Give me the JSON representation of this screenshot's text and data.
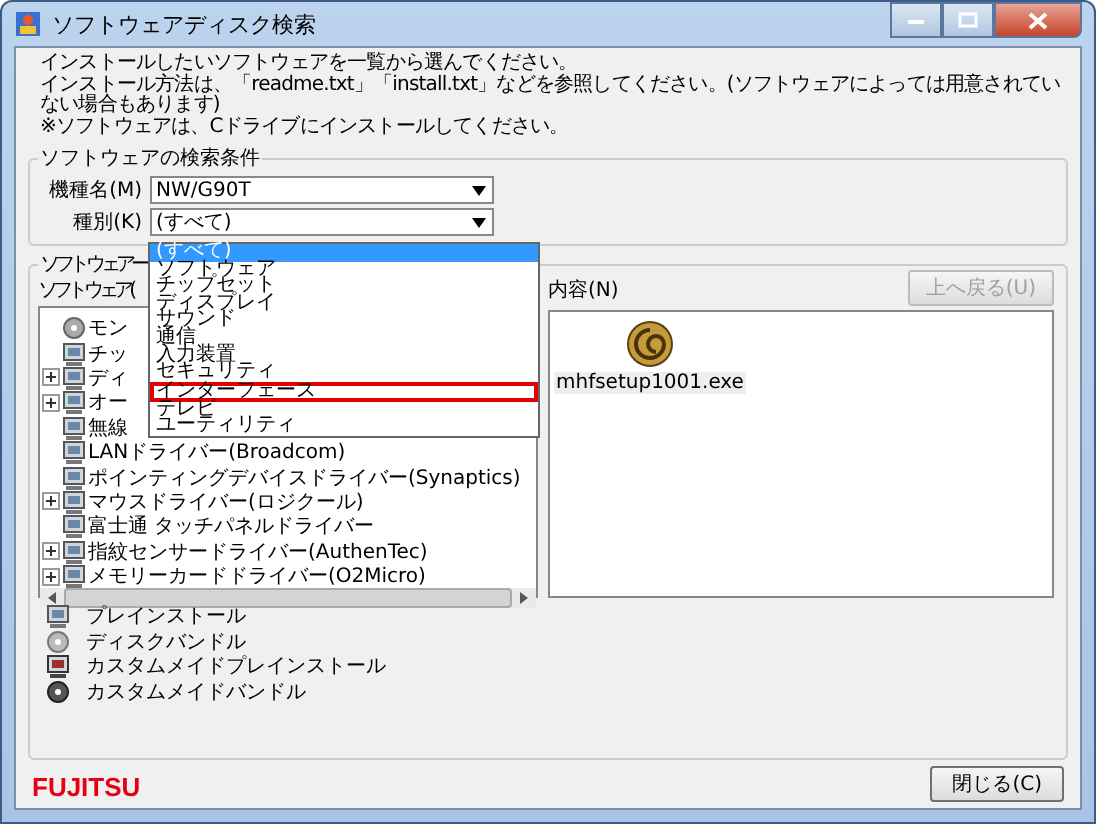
{
  "window": {
    "title": "ソフトウェアディスク検索"
  },
  "intro": [
    "インストールしたいソフトウェアを一覧から選んでください。",
    "インストール方法は、「readme.txt」「install.txt」などを参照してください。(ソフトウェアによっては用意されていない場合もあります)",
    "※ソフトウェアは、Cドライブにインストールしてください。"
  ],
  "search": {
    "legend": "ソフトウェアの検索条件",
    "model_label": "機種名(M)",
    "model_value": "NW/G90T",
    "type_label": "種別(K)",
    "type_value": "(すべて)",
    "type_options": [
      {
        "label": "(すべて)",
        "selected": true,
        "emphasized": false
      },
      {
        "label": "ソフトウェア",
        "selected": false,
        "emphasized": false
      },
      {
        "label": "チップセット",
        "selected": false,
        "emphasized": false
      },
      {
        "label": "ディスプレイ",
        "selected": false,
        "emphasized": false
      },
      {
        "label": "サウンド",
        "selected": false,
        "emphasized": false
      },
      {
        "label": "通信",
        "selected": false,
        "emphasized": false
      },
      {
        "label": "入力装置",
        "selected": false,
        "emphasized": false
      },
      {
        "label": "セキュリティ",
        "selected": false,
        "emphasized": false
      },
      {
        "label": "インターフェース",
        "selected": false,
        "emphasized": true
      },
      {
        "label": "テレビ",
        "selected": false,
        "emphasized": false
      },
      {
        "label": "ユーティリティ",
        "selected": false,
        "emphasized": false
      }
    ]
  },
  "list": {
    "legend": "ソフトウェアー",
    "tree_label": "ソフトウェア(",
    "tree": [
      {
        "label": "モン",
        "kind": "disc",
        "expandable": false
      },
      {
        "label": "チッ",
        "kind": "preinstall",
        "expandable": false
      },
      {
        "label": "ディ",
        "kind": "preinstall",
        "expandable": true
      },
      {
        "label": "オー",
        "kind": "preinstall",
        "expandable": true
      },
      {
        "label": "無線",
        "kind": "preinstall",
        "expandable": false
      },
      {
        "label": "LANドライバー(Broadcom)",
        "kind": "preinstall",
        "expandable": false
      },
      {
        "label": "ポインティングデバイスドライバー(Synaptics)",
        "kind": "preinstall",
        "expandable": false
      },
      {
        "label": "マウスドライバー(ロジクール)",
        "kind": "preinstall",
        "expandable": true
      },
      {
        "label": "富士通 タッチパネルドライバー",
        "kind": "preinstall",
        "expandable": false
      },
      {
        "label": "指紋センサードライバー(AuthenTec)",
        "kind": "preinstall",
        "expandable": true
      },
      {
        "label": "メモリーカードドライバー(O2Micro)",
        "kind": "preinstall",
        "expandable": true
      }
    ],
    "content_label": "内容(N)",
    "up_button": {
      "label": "上へ戻る(U)",
      "disabled": true
    },
    "files": [
      "mhfsetup1001.exe"
    ]
  },
  "legend": [
    {
      "label": "プレインストール",
      "kind": "preinstall"
    },
    {
      "label": "ディスクバンドル",
      "kind": "disc"
    },
    {
      "label": "カスタムメイドプレインストール",
      "kind": "custom-preinstall"
    },
    {
      "label": "カスタムメイドバンドル",
      "kind": "custom-disc"
    }
  ],
  "logo": "FUJITSU",
  "close_button": "閉じる(C)"
}
